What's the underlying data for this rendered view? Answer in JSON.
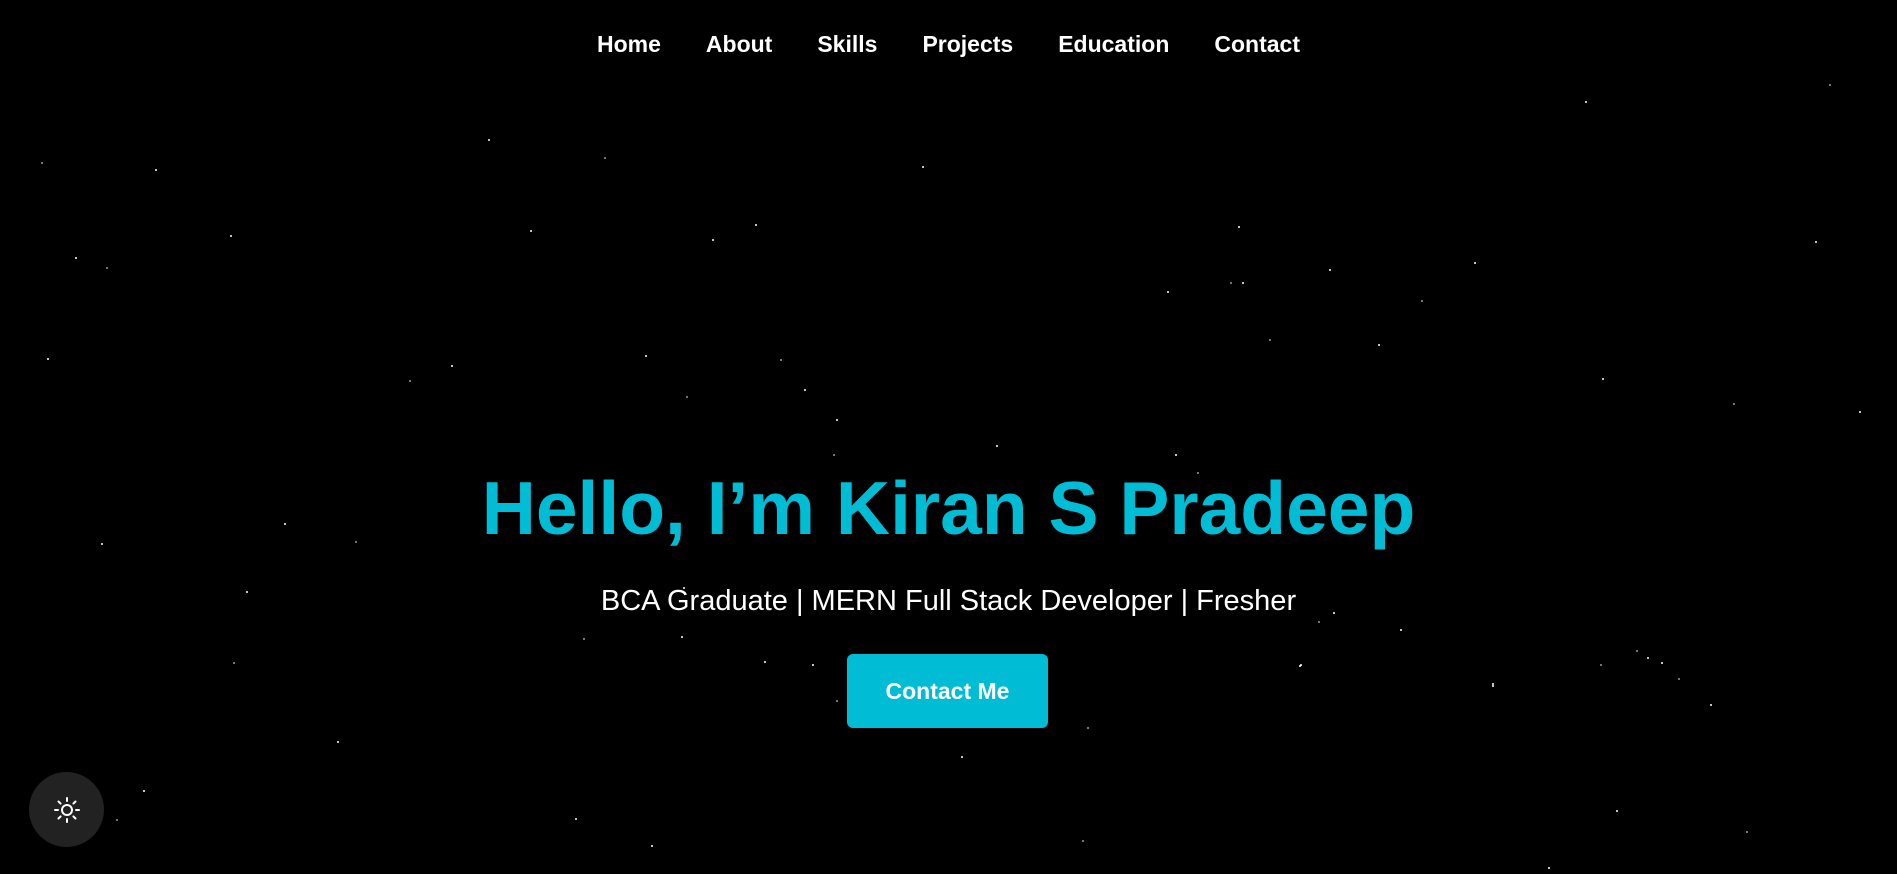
{
  "nav": {
    "items": [
      {
        "label": "Home"
      },
      {
        "label": "About"
      },
      {
        "label": "Skills"
      },
      {
        "label": "Projects"
      },
      {
        "label": "Education"
      },
      {
        "label": "Contact"
      }
    ]
  },
  "hero": {
    "title": "Hello, I’m Kiran S Pradeep",
    "subtitle": "BCA Graduate | MERN Full Stack Developer | Fresher",
    "cta_label": "Contact Me"
  },
  "theme_toggle": {
    "icon": "sun-icon"
  },
  "colors": {
    "background": "#000000",
    "accent": "#00bcd4",
    "text": "#ffffff",
    "toggle_bg": "#222222"
  }
}
